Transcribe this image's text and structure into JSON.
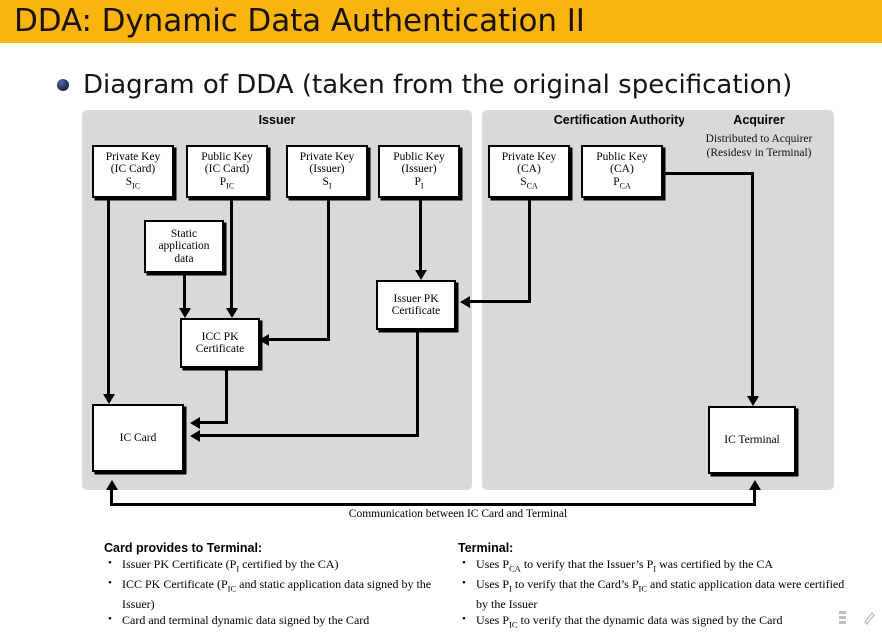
{
  "slide": {
    "title": "DDA: Dynamic Data Authentication II",
    "title_band_color": "#F9B410",
    "bullet_text": "Diagram of DDA (taken from the original specification)",
    "bullet_color": "#2b3566"
  },
  "diagram": {
    "panels": [
      {
        "id": "issuer",
        "title": "Issuer",
        "subtitle": ""
      },
      {
        "id": "ca",
        "title": "Certification Authority",
        "subtitle": ""
      },
      {
        "id": "acquirer",
        "title": "Acquirer",
        "subtitle_line1": "Distributed to Acquirer",
        "subtitle_line2": "(Residesv in Terminal)"
      }
    ],
    "boxes": {
      "priv_ic": {
        "l1": "Private Key",
        "l2": "(IC Card)",
        "sym": "S",
        "sub": "IC"
      },
      "pub_ic": {
        "l1": "Public Key",
        "l2": "(IC Card)",
        "sym": "P",
        "sub": "IC"
      },
      "priv_issuer": {
        "l1": "Private Key",
        "l2": "(Issuer)",
        "sym": "S",
        "sub": "I"
      },
      "pub_issuer": {
        "l1": "Public Key",
        "l2": "(Issuer)",
        "sym": "P",
        "sub": "I"
      },
      "priv_ca": {
        "l1": "Private Key",
        "l2": "(CA)",
        "sym": "S",
        "sub": "CA"
      },
      "pub_ca": {
        "l1": "Public Key",
        "l2": "(CA)",
        "sym": "P",
        "sub": "CA"
      },
      "static_data": {
        "l1": "Static",
        "l2": "application",
        "l3": "data"
      },
      "icc_pk_cert": {
        "l1": "ICC PK",
        "l2": "Certificate"
      },
      "issuer_pk_cert": {
        "l1": "Issuer PK",
        "l2": "Certificate"
      },
      "ic_card": {
        "l1": "IC Card"
      },
      "ic_terminal": {
        "l1": "IC Terminal"
      }
    },
    "comm_label": "Communication between IC Card and Terminal"
  },
  "notes": {
    "card": {
      "heading": "Card provides to Terminal:",
      "items": [
        "Issuer PK Certificate (P<sub>I</sub> certified by the CA)",
        "ICC PK Certificate (P<sub>IC</sub> and static application data signed by the Issuer)",
        "Card and terminal dynamic data signed by the Card"
      ]
    },
    "terminal": {
      "heading": "Terminal:",
      "items": [
        "Uses P<sub>CA</sub> to verify that the Issuer’s P<sub>I</sub> was certified by the CA",
        "Uses P<sub>I</sub> to verify that the Card’s P<sub>IC</sub> and static application data were certified by the Issuer",
        "Uses P<sub>IC</sub> to verify that the dynamic data was signed by the Card"
      ]
    }
  },
  "status_icons": [
    "list-icon",
    "pen-icon"
  ]
}
